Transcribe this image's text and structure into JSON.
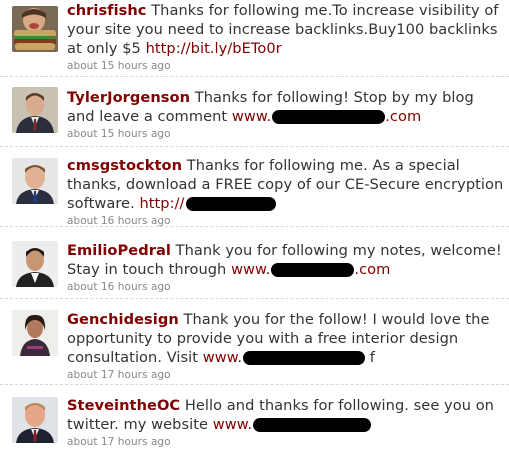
{
  "tweets": [
    {
      "screen_name": "chrisfishc",
      "text": "Thanks for following me.To increase visibility of your site you need to increase backlinks.Buy100 backlinks at only $5",
      "link": "http://bit.ly/bETo0r",
      "time": "about 15 hours ago"
    },
    {
      "screen_name": "TylerJorgenson",
      "text": "Thanks for following! Stop by my blog and leave a comment",
      "link_prefix": "www.",
      "link_suffix": ".com",
      "time": "about 15 hours ago"
    },
    {
      "screen_name": "cmsgstockton",
      "text": "Thanks for following me. As a special thanks, download a FREE copy of our CE-Secure encryption software.",
      "link_prefix": "http://",
      "time": "about 16 hours ago"
    },
    {
      "screen_name": "EmilioPedral",
      "text": "Thank you for following my notes, welcome! Stay in touch through",
      "link_prefix": "www.",
      "link_suffix": ".com",
      "time": "about 16 hours ago"
    },
    {
      "screen_name": "Genchidesign",
      "text": "Thank you for the follow! I would love the opportunity to provide you with a free interior design consultation. Visit",
      "link_prefix": "www.",
      "trailing": "f",
      "time": "about 17 hours ago"
    },
    {
      "screen_name": "SteveintheOC",
      "text": "Hello and thanks for following. see you on twitter. my website",
      "link_prefix": "www.",
      "time": "about 17 hours ago"
    }
  ],
  "colors": {
    "link": "#800000",
    "text": "#333333",
    "meta": "#888888",
    "redaction": "#000000"
  }
}
